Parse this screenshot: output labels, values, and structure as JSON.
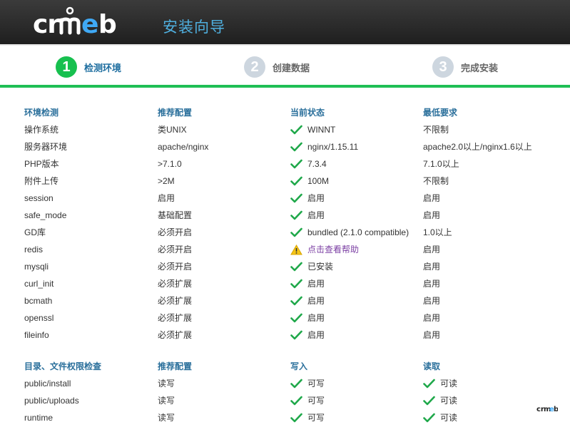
{
  "header": {
    "logo_text": "crmeb",
    "title": "安装向导"
  },
  "steps": [
    {
      "num": "1",
      "label": "检测环境",
      "active": true
    },
    {
      "num": "2",
      "label": "创建数据",
      "active": false
    },
    {
      "num": "3",
      "label": "完成安装",
      "active": false
    }
  ],
  "env": {
    "headers": [
      "环境检测",
      "推荐配置",
      "当前状态",
      "最低要求"
    ],
    "rows": [
      [
        "操作系统",
        "类UNIX",
        "WINNT",
        "不限制"
      ],
      [
        "服务器环境",
        "apache/nginx",
        "nginx/1.15.11",
        "apache2.0以上/nginx1.6以上"
      ],
      [
        "PHP版本",
        ">7.1.0",
        "7.3.4",
        "7.1.0以上"
      ],
      [
        "附件上传",
        ">2M",
        "100M",
        "不限制"
      ],
      [
        "session",
        "启用",
        "启用",
        "启用"
      ],
      [
        "safe_mode",
        "基础配置",
        "启用",
        "启用"
      ],
      [
        "GD库",
        "必须开启",
        "bundled (2.1.0 compatible)",
        "1.0以上"
      ],
      [
        "redis",
        "必须开启",
        "点击查看帮助",
        "启用"
      ],
      [
        "mysqli",
        "必须开启",
        "已安装",
        "启用"
      ],
      [
        "curl_init",
        "必须扩展",
        "启用",
        "启用"
      ],
      [
        "bcmath",
        "必须扩展",
        "启用",
        "启用"
      ],
      [
        "openssl",
        "必须扩展",
        "启用",
        "启用"
      ],
      [
        "fileinfo",
        "必须扩展",
        "启用",
        "启用"
      ]
    ],
    "status_icons": [
      "check",
      "check",
      "check",
      "check",
      "check",
      "check",
      "check",
      "warning",
      "check",
      "check",
      "check",
      "check",
      "check"
    ]
  },
  "dirs": {
    "headers": [
      "目录、文件权限检查",
      "推荐配置",
      "写入",
      "读取"
    ],
    "rows": [
      [
        "public/install",
        "读写",
        "可写",
        "可读"
      ],
      [
        "public/uploads",
        "读写",
        "可写",
        "可读"
      ],
      [
        "runtime",
        "读写",
        "可写",
        "可读"
      ]
    ]
  },
  "colors": {
    "accent_green": "#1fbf55",
    "header_blue": "#2a6f9b",
    "title_blue": "#4fb0e0",
    "warning_link": "#7b3fa3"
  },
  "footer": {
    "mini_logo_text": "crmeb"
  }
}
